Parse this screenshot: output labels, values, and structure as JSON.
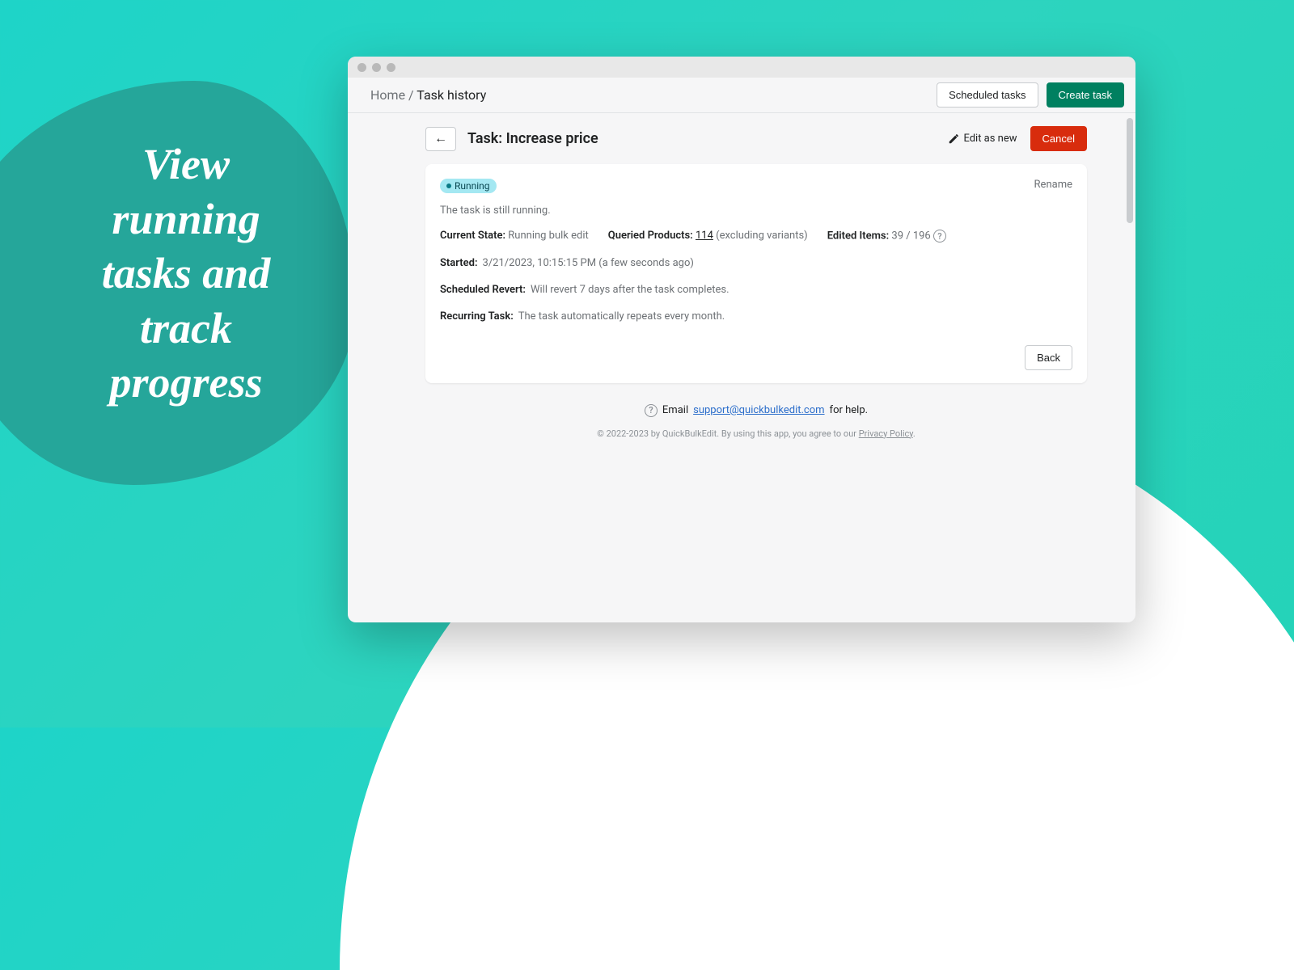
{
  "promo": "View running tasks and track progress",
  "breadcrumb": {
    "root": "Home",
    "sep": "/",
    "current": "Task history"
  },
  "header": {
    "scheduled_btn": "Scheduled tasks",
    "create_btn": "Create task"
  },
  "pagehead": {
    "back_glyph": "←",
    "title": "Task: Increase price",
    "edit_as_new": "Edit as new",
    "cancel": "Cancel"
  },
  "card": {
    "badge": "Running",
    "rename": "Rename",
    "status_line": "The task is still running.",
    "current_state_label": "Current State:",
    "current_state_value": "Running bulk edit",
    "queried_label": "Queried Products:",
    "queried_count": "114",
    "queried_note": "(excluding variants)",
    "edited_label": "Edited Items:",
    "edited_value": "39 / 196",
    "started_label": "Started:",
    "started_value": "3/21/2023, 10:15:15 PM (a few seconds ago)",
    "revert_label": "Scheduled Revert:",
    "revert_value": "Will revert 7 days after the task completes.",
    "recurring_label": "Recurring Task:",
    "recurring_value": "The task automatically repeats every month.",
    "back_btn": "Back"
  },
  "footer": {
    "help_prefix": "Email",
    "help_email": "support@quickbulkedit.com",
    "help_suffix": "for help.",
    "copy_prefix": "© 2022-2023 by QuickBulkEdit. By using this app, you agree to our",
    "privacy": "Privacy Policy",
    "copy_suffix": "."
  }
}
